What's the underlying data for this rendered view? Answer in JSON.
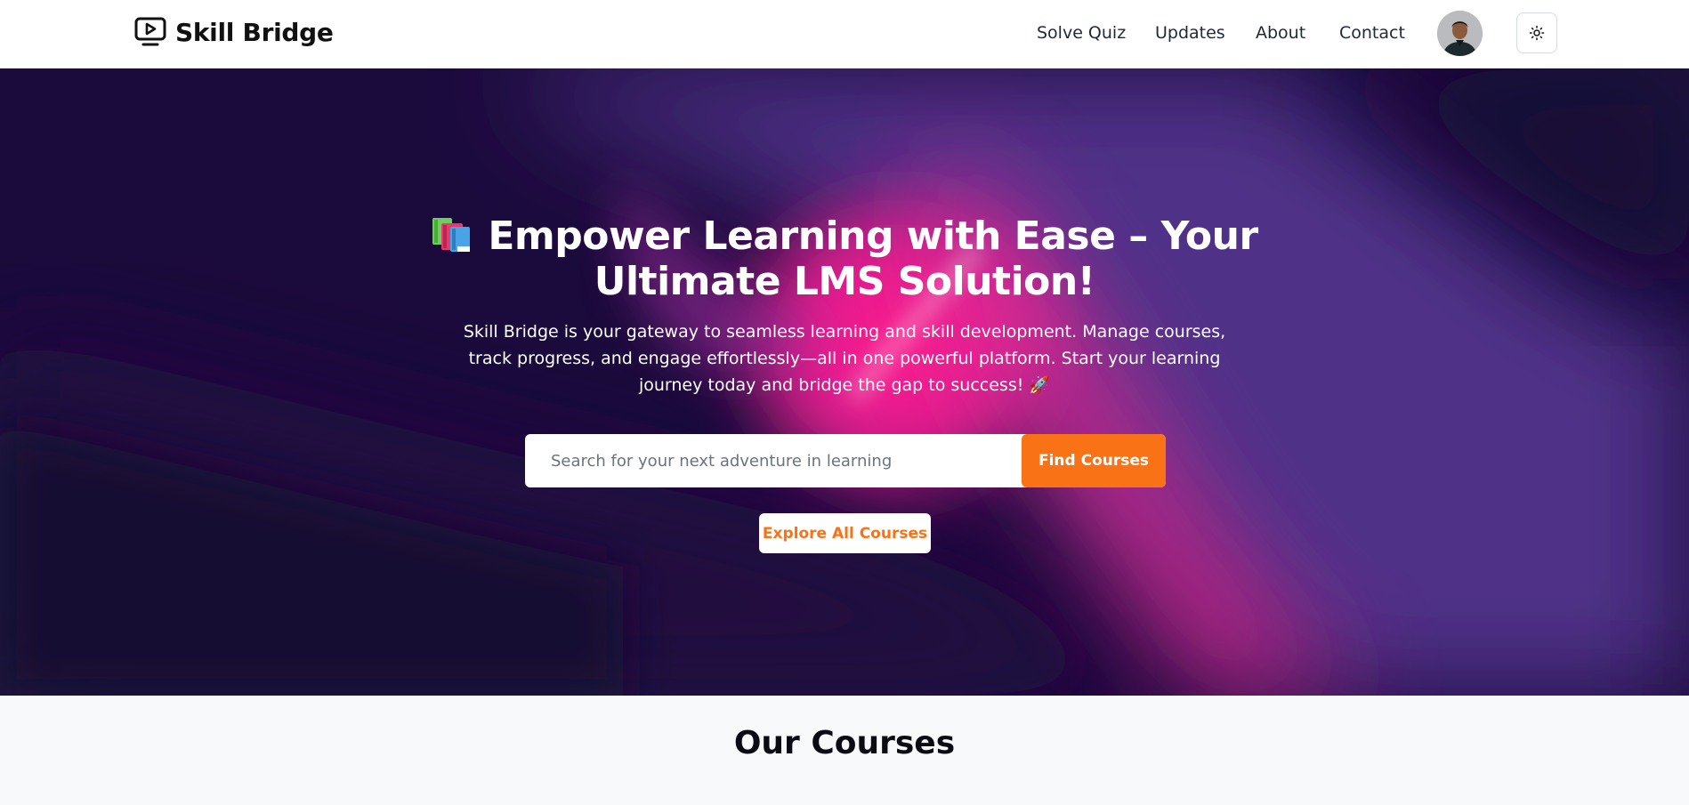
{
  "brand": {
    "name": "Skill Bridge",
    "icon": "video-play-icon"
  },
  "nav": {
    "links": [
      "Solve Quiz",
      "Updates",
      "About",
      "Contact"
    ],
    "avatar_icon": "user-avatar",
    "theme_icon": "sun-icon"
  },
  "hero": {
    "title_icon": "books-emoji",
    "title": "Empower Learning with Ease – Your Ultimate LMS Solution!",
    "description": "Skill Bridge is your gateway to seamless learning and skill development. Manage courses, track progress, and engage effortlessly—all in one powerful platform. Start your learning journey today and bridge the gap to success! 🚀",
    "search": {
      "placeholder": "Search for your next adventure in learning",
      "value": "",
      "button_label": "Find Courses"
    },
    "explore_label": "Explore All Courses"
  },
  "courses": {
    "title": "Our Courses"
  },
  "colors": {
    "accent": "#f97316",
    "hero_dark": "#1b0a3c",
    "hero_purple": "#5b3a9c",
    "hero_pink": "#ff1493"
  }
}
